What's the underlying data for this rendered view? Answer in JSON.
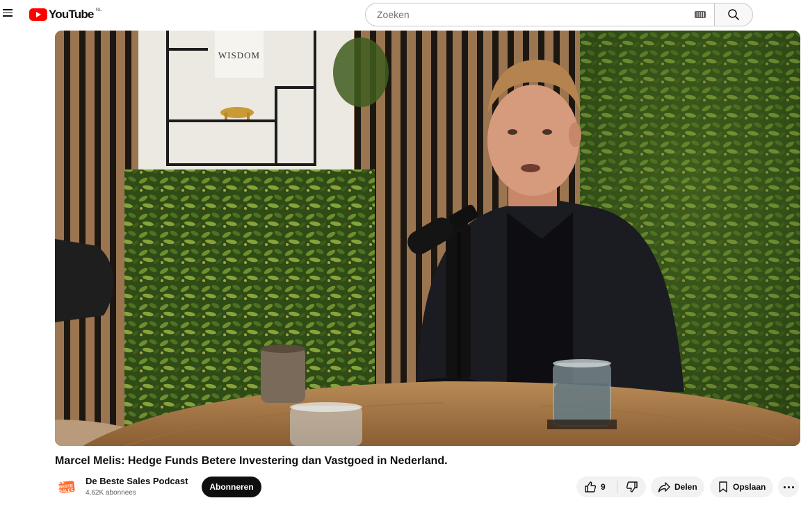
{
  "header": {
    "logo_text": "YouTube",
    "region": "NL",
    "search_placeholder": "Zoeken"
  },
  "icons": {
    "menu": "hamburger-menu-icon",
    "keyboard": "keyboard-icon",
    "search": "magnifier-icon",
    "like": "thumbs-up-icon",
    "dislike": "thumbs-down-icon",
    "share": "share-arrow-icon",
    "save": "bookmark-icon",
    "more": "horizontal-ellipsis-icon"
  },
  "video": {
    "poster_text": "WISDOM",
    "title": "Marcel Melis: Hedge Funds Betere Investering dan Vastgoed in Nederland."
  },
  "channel": {
    "name": "De Beste Sales Podcast",
    "subscribers": "4,62K abonnees",
    "avatar_text": "DE BESTE SALES"
  },
  "actions": {
    "subscribe": "Abonneren",
    "like_count": "9",
    "share": "Delen",
    "save": "Opslaan"
  },
  "colors": {
    "brand_red": "#ff0000",
    "subscribe_bg": "#0f0f0f",
    "pill_bg": "#f2f2f2",
    "avatar_orange": "#ff6a2b"
  }
}
